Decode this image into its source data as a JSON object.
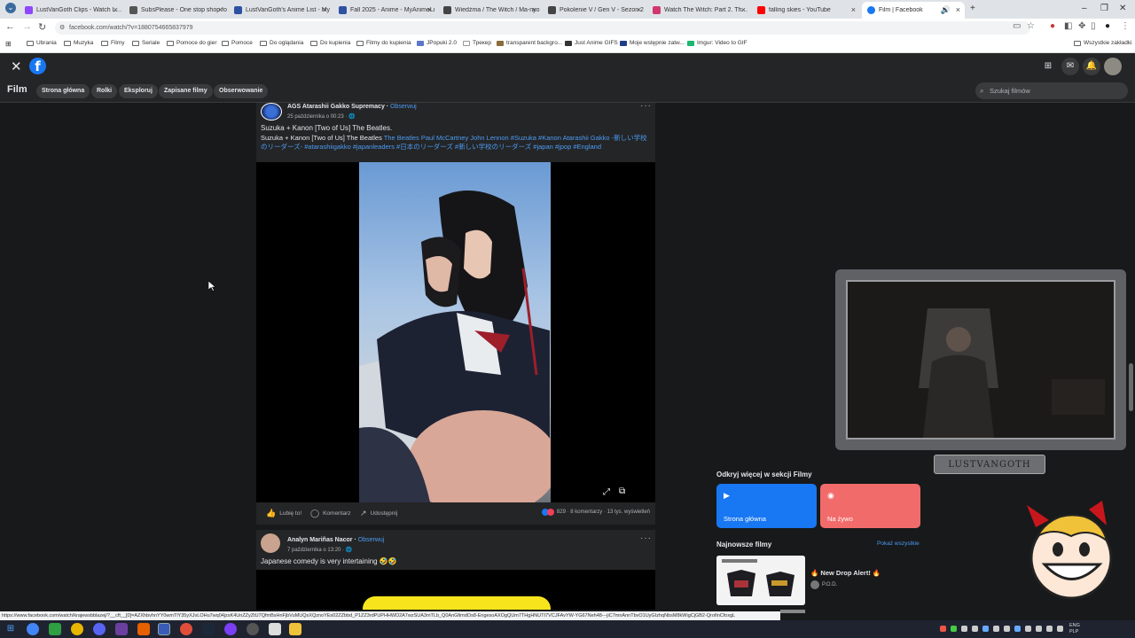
{
  "browser": {
    "tabs": [
      {
        "label": "LustVanGoth Clips - Watch Live",
        "color": "#9146ff"
      },
      {
        "label": "SubsPlease - One stop shop fo",
        "color": "#555555"
      },
      {
        "label": "LustVanGoth's Anime List - My",
        "color": "#2e51a2"
      },
      {
        "label": "Fall 2025 - Anime - MyAnimeLi",
        "color": "#2e51a2"
      },
      {
        "label": "Wiedźma / The Witch / Ma-nyo",
        "color": "#444444"
      },
      {
        "label": "Pokolenie V / Gen V - Sezon 2",
        "color": "#444444"
      },
      {
        "label": "Watch The Witch: Part 2. The O",
        "color": "#d2366c"
      },
      {
        "label": "falling skies - YouTube",
        "color": "#ff0000"
      },
      {
        "label": "Film | Facebook",
        "color": "#1877f2"
      }
    ],
    "url": "facebook.com/watch/?v=1880754665837979",
    "bookmarks": [
      "Ubrania",
      "Muzyka",
      "Filmy",
      "Seriale",
      "Pomoce do gier",
      "Pomoce",
      "Do oglądania",
      "Do kupienia",
      "Filmy do kupienia",
      "JPopuki 2.0",
      "Трекер",
      "transparent backgro...",
      "Just Anime GIFS",
      "Moje wstępnie zatw...",
      "Imgur: Video to GIF"
    ],
    "all_bookmarks": "Wszystkie zakładki",
    "status_url": "https://www.facebook.com/watch/krajewsbblazej/?__cft__[0]=AZXhbvhnYY0wmTlY35yXJvLOHu7wq04jzsK4UnZZyZtU7QfmBsHnFjbVuMUQsXQznoYEs02ZZbbd_P1ZZ3rdPUPHHWD2A7wzSUA3mTLb_Q0AnGfimdOs8-EngesoAXOgQUm7THgHNUTI7VCJFAvYW-YG67Neh48---jiC7mnAnnTbvO1UyGIzhqNbsM8kWigCjGB2-QrofinCfoxgL"
  },
  "header": {
    "close_glyph": "✕",
    "logo_letter": "f",
    "icons": [
      "grid-icon",
      "messenger-icon",
      "bell-icon",
      "avatar"
    ]
  },
  "subnav": {
    "title": "Film",
    "items": [
      "Strona główna",
      "Rolki",
      "Eksploruj",
      "Zapisane filmy",
      "Obserwowanie"
    ],
    "search_placeholder": "Szukaj filmów"
  },
  "post1": {
    "author": "AGS Atarashii Gakko Supremacy",
    "sep": " · ",
    "follow": "Obserwuj",
    "date": "25 października o 00:23 · 🌐",
    "title": "Suzuka + Kanon [Two of Us] The Beatles.",
    "desc_plain": "Suzuka + Kanon [Two of Us] The Beatles ",
    "desc_tags": "The Beatles Paul McCartney John Lennon #Suzuka #Kanon Atarashii Gakko -新しい学校のリーダーズ- #atarashiigakko #japanleaders #日本のリーダーズ #新しい学校のリーダーズ #japan #jpop #England",
    "actions": {
      "like": "Lubię to!",
      "comment": "Komentarz",
      "share": "Udostępnij"
    },
    "stats": {
      "reactions": "829",
      "comments": "8 komentarzy",
      "views": "13 tys. wyświetleń"
    }
  },
  "post2": {
    "author": "Analyn Mariñas Nacor",
    "sep": " · ",
    "follow": "Obserwuj",
    "date": "7 października o 13:20 · 🌐",
    "text": "Japanese comedy is very intertaining 🤣🤣"
  },
  "sidebar": {
    "discover_title": "Odkryj więcej w sekcji Filmy",
    "cards": [
      {
        "label": "Strona główna",
        "color": "#1877f2"
      },
      {
        "label": "Na żywo",
        "color": "#f26b6b"
      }
    ],
    "newest_title": "Najnowsze filmy",
    "show_all": "Pokaż wszystkie",
    "video": {
      "title": "🔥 New Drop Alert! 🔥",
      "channel": "P.O.D."
    }
  },
  "overlay": {
    "webcam_name": "LUSTVANGOTH"
  },
  "taskbar": {
    "lang": "ENG",
    "layout": "PLP"
  },
  "colors": {
    "fb_blue": "#1877f2",
    "link": "#4b9cf5",
    "page_bg": "#18191a",
    "card_bg": "#242526"
  }
}
